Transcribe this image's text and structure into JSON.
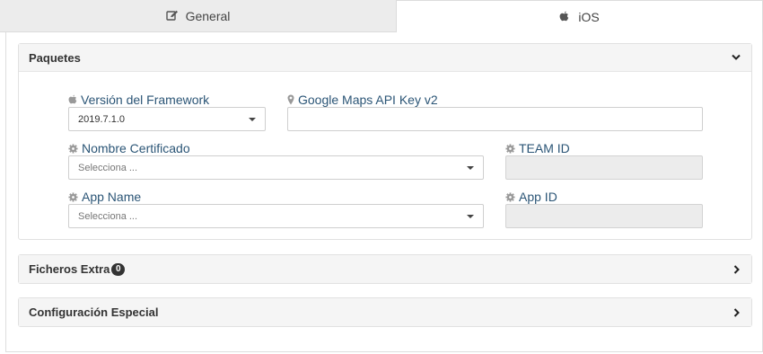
{
  "tabs": {
    "general": {
      "label": "General",
      "icon": "edit-icon"
    },
    "ios": {
      "label": "iOS",
      "icon": "apple-icon"
    }
  },
  "panels": {
    "paquetes": {
      "title": "Paquetes",
      "expanded": true,
      "fields": {
        "framework_version": {
          "label": "Versión del Framework",
          "icon": "apple-icon",
          "value": "2019.7.1.0"
        },
        "google_maps_key": {
          "label": "Google Maps API Key v2",
          "icon": "map-marker-icon",
          "value": ""
        },
        "certificate_name": {
          "label": "Nombre Certificado",
          "icon": "gear-icon",
          "placeholder": "Selecciona ..."
        },
        "team_id": {
          "label": "TEAM ID",
          "icon": "gear-icon",
          "value": ""
        },
        "app_name": {
          "label": "App Name",
          "icon": "gear-icon",
          "placeholder": "Selecciona ..."
        },
        "app_id": {
          "label": "App ID",
          "icon": "gear-icon",
          "value": ""
        }
      }
    },
    "ficheros_extra": {
      "title": "Ficheros Extra",
      "badge": "0",
      "expanded": false
    },
    "configuracion_especial": {
      "title": "Configuración Especial",
      "expanded": false
    }
  },
  "colors": {
    "label_text": "#2b5576",
    "panel_header_bg": "#f5f5f5",
    "tab_inactive_bg": "#ececec",
    "disabled_input_bg": "#ececec"
  }
}
